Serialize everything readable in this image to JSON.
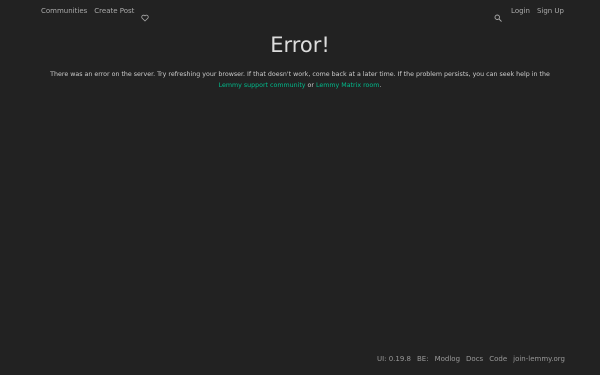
{
  "nav": {
    "communities": "Communities",
    "create_post": "Create Post",
    "donate_icon": "heart-icon",
    "search_icon": "search-icon",
    "login": "Login",
    "signup": "Sign Up"
  },
  "error": {
    "title": "Error!",
    "message_part1": "There was an error on the server. Try refreshing your browser. If that doesn't work, come back at a later time. If the problem persists, you can seek help in the ",
    "support_link": "Lemmy support community",
    "message_or": " or ",
    "matrix_link": "Lemmy Matrix room",
    "message_end": "."
  },
  "footer": {
    "ui_version": "UI: 0.19.8",
    "be_version": "BE:",
    "modlog": "Modlog",
    "docs": "Docs",
    "code": "Code",
    "join": "join-lemmy.org"
  },
  "colors": {
    "background": "#222222",
    "link": "#00bc8c",
    "nav_text": "#aaaaaa"
  }
}
